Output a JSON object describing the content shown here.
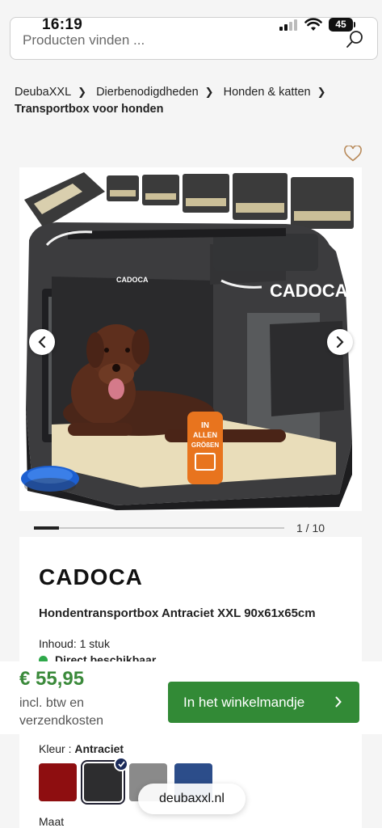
{
  "status_bar": {
    "time": "16:19",
    "battery": "45"
  },
  "search": {
    "placeholder": "Producten vinden ..."
  },
  "breadcrumb": {
    "items": [
      "DeubaXXL",
      "Dierbenodigdheden",
      "Honden & katten"
    ],
    "current": "Transportbox voor honden"
  },
  "gallery": {
    "counter": "1 / 10",
    "position": 1,
    "total": 10,
    "bag_logo": "CADOCA",
    "badge_line1": "IN",
    "badge_line2": "ALLEN",
    "badge_line3": "GRÖßEN"
  },
  "product": {
    "brand": "CADOCA",
    "title": "Hondentransportbox Antraciet XXL 90x61x65cm",
    "content": "Inhoud: 1 stuk",
    "stock": "Direct beschikbaar",
    "stock_color": "#2ea84a"
  },
  "purchase": {
    "price": "€ 55,95",
    "price_note": "incl. btw en verzendkosten",
    "cart_button": "In het winkelmandje",
    "accent_color": "#328a36"
  },
  "color_selector": {
    "label": "Kleur : ",
    "selected": "Antraciet",
    "swatches": [
      {
        "name": "red",
        "color": "#8e0e10",
        "selected": false
      },
      {
        "name": "anthracite",
        "color": "#2d2d2f",
        "selected": true
      },
      {
        "name": "grey",
        "color": "#8a8a8a",
        "selected": false
      },
      {
        "name": "blue",
        "color": "#2c4d8a",
        "selected": false
      }
    ]
  },
  "size_selector": {
    "label": "Maat"
  },
  "browser": {
    "url": "deubaxxl.nl"
  }
}
